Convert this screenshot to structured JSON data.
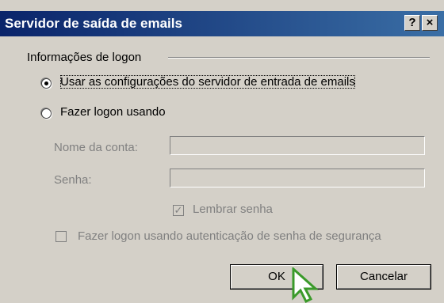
{
  "window": {
    "title": "Servidor de saída de emails",
    "help_label": "?",
    "close_label": "×"
  },
  "group": {
    "label": "Informações de logon"
  },
  "options": {
    "use_incoming": {
      "label": "Usar as configurações do servidor de entrada de emails",
      "selected": true
    },
    "logon_using": {
      "label": "Fazer logon usando",
      "selected": false
    }
  },
  "fields": {
    "account_label": "Nome da conta:",
    "account_value": "",
    "password_label": "Senha:",
    "password_value": ""
  },
  "remember": {
    "label": "Lembrar senha",
    "checked": true
  },
  "spa": {
    "label": "Fazer logon usando autenticação de senha de segurança",
    "checked": false
  },
  "buttons": {
    "ok": "OK",
    "cancel": "Cancelar"
  }
}
